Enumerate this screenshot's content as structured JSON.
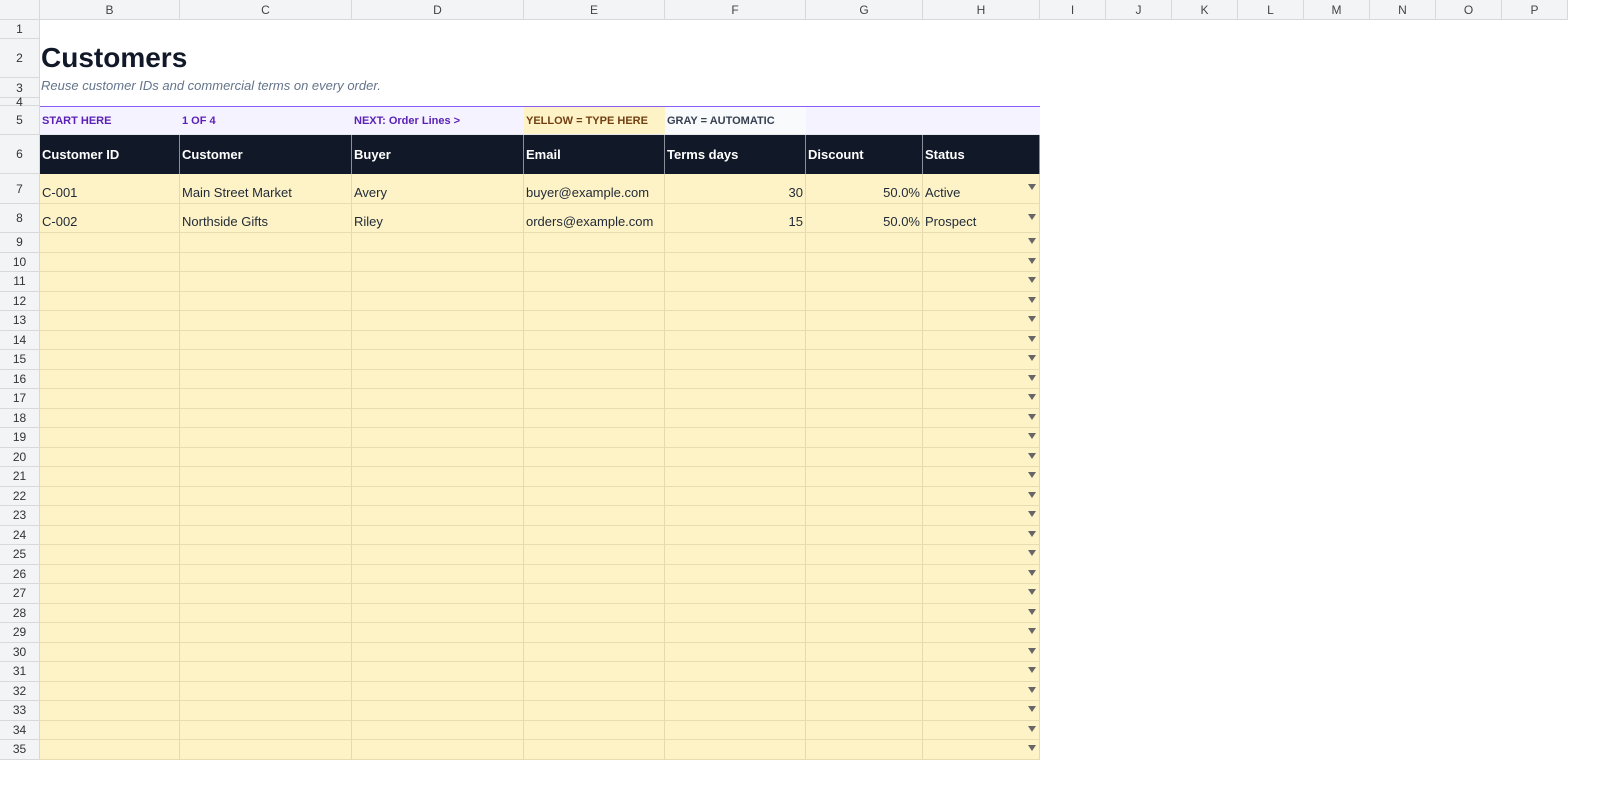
{
  "grid": {
    "columns": [
      "B",
      "C",
      "D",
      "E",
      "F",
      "G",
      "H",
      "I",
      "J",
      "K",
      "L",
      "M",
      "N",
      "O",
      "P"
    ],
    "rows": [
      "1",
      "2",
      "3",
      "4",
      "5",
      "6",
      "7",
      "8",
      "9",
      "10",
      "11",
      "12",
      "13",
      "14",
      "15",
      "16",
      "17",
      "18",
      "19",
      "20",
      "21",
      "22",
      "23",
      "24",
      "25",
      "26",
      "27",
      "28",
      "29",
      "30",
      "31",
      "32",
      "33",
      "34",
      "35"
    ]
  },
  "sheet": {
    "title": "Customers",
    "subtitle": "Reuse customer IDs and commercial terms on every order."
  },
  "banner": {
    "start": "START HERE",
    "step": "1 OF 4",
    "next": "NEXT: Order Lines  >",
    "legend_input": "YELLOW = TYPE HERE",
    "legend_auto": "GRAY = AUTOMATIC"
  },
  "table": {
    "headers": [
      "Customer ID",
      "Customer",
      "Buyer",
      "Email",
      "Terms days",
      "Discount",
      "Status"
    ],
    "rows": [
      [
        "C-001",
        "Main Street Market",
        "Avery",
        "buyer@example.com",
        "30",
        "50.0%",
        "Active"
      ],
      [
        "C-002",
        "Northside Gifts",
        "Riley",
        "orders@example.com",
        "15",
        "50.0%",
        "Prospect"
      ]
    ]
  },
  "colors": {
    "header_bg": "#111827",
    "input_bg": "#fef3c7",
    "banner_bg": "#f5f3ff",
    "banner_text": "#5b21b6",
    "banner_border": "#8b5cf6"
  },
  "icons": {
    "status_dropdown": "chevron-down-icon"
  }
}
